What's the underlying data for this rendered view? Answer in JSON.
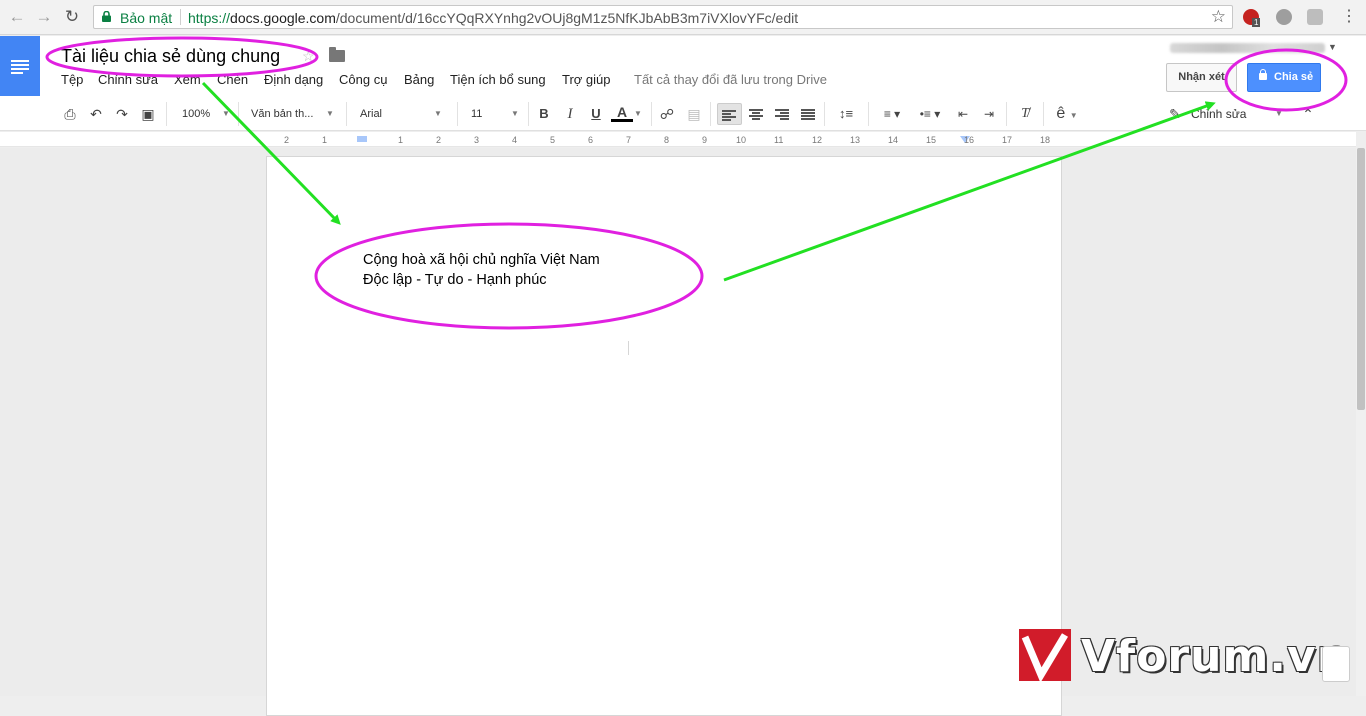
{
  "browser": {
    "secure_label": "Bảo mật",
    "url_scheme": "https://",
    "url_host": "docs.google.com",
    "url_path": "/document/d/16ccYQqRXYnhg2vOUj8gM1z5NfKJbAbB3m7iVXlovYFc/edit",
    "extension_badge": "1"
  },
  "docs": {
    "title": "Tài liệu chia sẻ dùng chung",
    "menu": [
      "Tệp",
      "Chỉnh sửa",
      "Xem",
      "Chèn",
      "Định dạng",
      "Công cụ",
      "Bảng",
      "Tiện ích bổ sung",
      "Trợ giúp"
    ],
    "save_status": "Tất cả thay đổi đã lưu trong Drive",
    "comment_label": "Nhận xét",
    "share_label": "Chia sẻ"
  },
  "toolbar": {
    "zoom": "100%",
    "style": "Văn bản th...",
    "font": "Arial",
    "size": "11",
    "bold": "B",
    "italic": "I",
    "underline": "U",
    "text_color": "A",
    "input_tools": "ê",
    "mode": "Chỉnh sửa"
  },
  "ruler": {
    "ticks": [
      "2",
      "1",
      "1",
      "2",
      "3",
      "4",
      "5",
      "6",
      "7",
      "8",
      "9",
      "10",
      "11",
      "12",
      "13",
      "14",
      "15",
      "16",
      "17",
      "18"
    ]
  },
  "document": {
    "lines": [
      "Cộng hoà xã hội chủ nghĩa Việt Nam",
      "Độc lập - Tự do - Hạnh phúc"
    ]
  },
  "watermark": {
    "text": "Vforum.vn"
  },
  "colors": {
    "annotation_ellipse": "#e020e0",
    "annotation_arrow": "#22e022",
    "docs_blue": "#4285f4",
    "share_blue": "#4d90fe"
  }
}
